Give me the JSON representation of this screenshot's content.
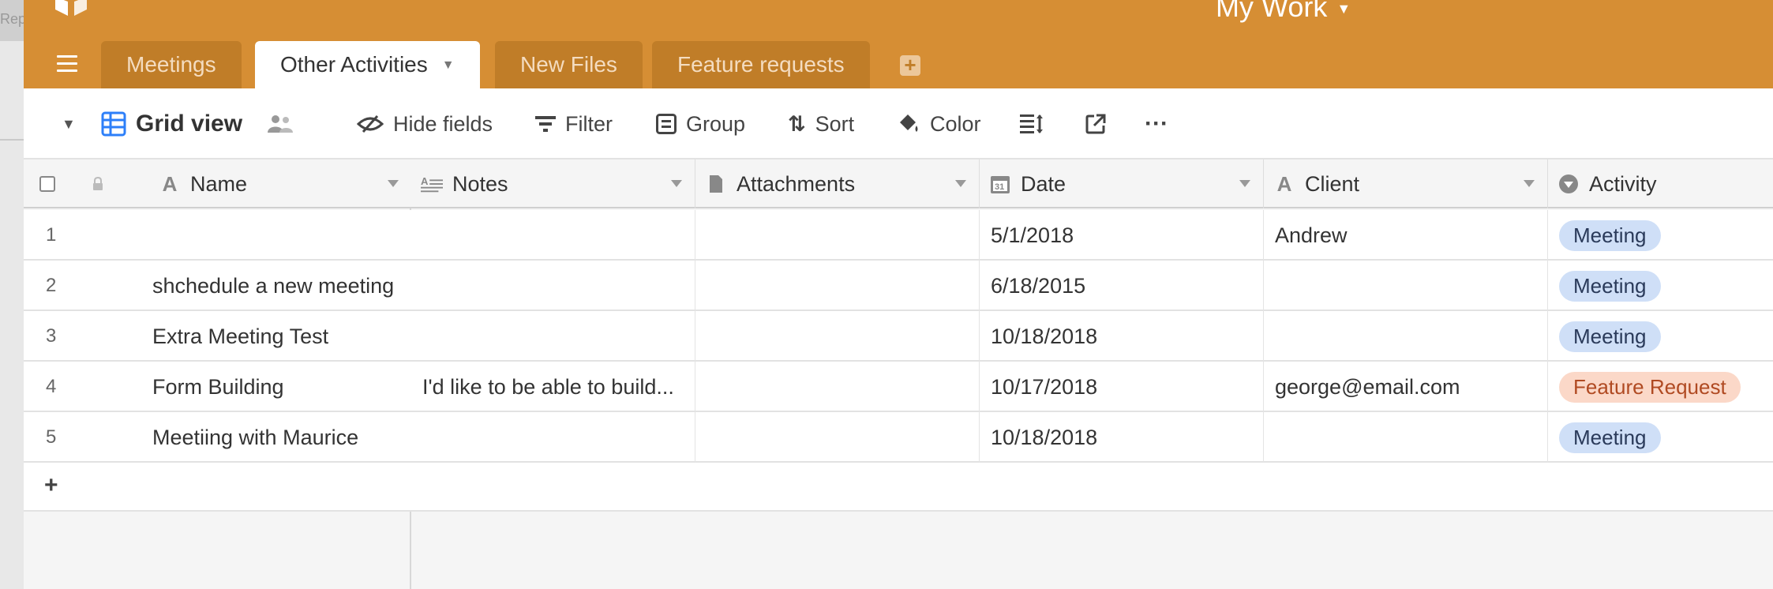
{
  "behind_window": {
    "label": "Rep"
  },
  "header": {
    "base_title": "My Work",
    "tabs": [
      {
        "label": "Meetings",
        "active": false
      },
      {
        "label": "Other Activities",
        "active": true
      },
      {
        "label": "New Files",
        "active": false
      },
      {
        "label": "Feature requests",
        "active": false
      }
    ]
  },
  "toolbar": {
    "view_name": "Grid view",
    "hide_fields": "Hide fields",
    "filter": "Filter",
    "group": "Group",
    "sort": "Sort",
    "color": "Color",
    "more": "···"
  },
  "table": {
    "columns": [
      {
        "name": "Name",
        "type_icon": "text-field-icon"
      },
      {
        "name": "Notes",
        "type_icon": "long-text-icon"
      },
      {
        "name": "Attachments",
        "type_icon": "attachment-icon"
      },
      {
        "name": "Date",
        "type_icon": "calendar-icon"
      },
      {
        "name": "Client",
        "type_icon": "text-field-icon"
      },
      {
        "name": "Activity",
        "type_icon": "single-select-icon"
      }
    ],
    "rows": [
      {
        "num": "1",
        "name": "",
        "notes": "",
        "attachments": "",
        "date": "5/1/2018",
        "client": "Andrew",
        "activity": "Meeting"
      },
      {
        "num": "2",
        "name": "shchedule a new meeting",
        "notes": "",
        "attachments": "",
        "date": "6/18/2015",
        "client": "",
        "activity": "Meeting"
      },
      {
        "num": "3",
        "name": "Extra Meeting Test",
        "notes": "",
        "attachments": "",
        "date": "10/18/2018",
        "client": "",
        "activity": "Meeting"
      },
      {
        "num": "4",
        "name": "Form Building",
        "notes": "I'd like to be able to build...",
        "attachments": "",
        "date": "10/17/2018",
        "client": "george@email.com",
        "activity": "Feature Request"
      },
      {
        "num": "5",
        "name": "Meetiing with Maurice",
        "notes": "",
        "attachments": "",
        "date": "10/18/2018",
        "client": "",
        "activity": "Meeting"
      }
    ],
    "add_row": "+"
  },
  "colors": {
    "header_bg": "#d68e34",
    "tab_inactive": "#c07d28",
    "pill_meeting": "#cfdff7",
    "pill_feature": "#fbd8c8"
  }
}
